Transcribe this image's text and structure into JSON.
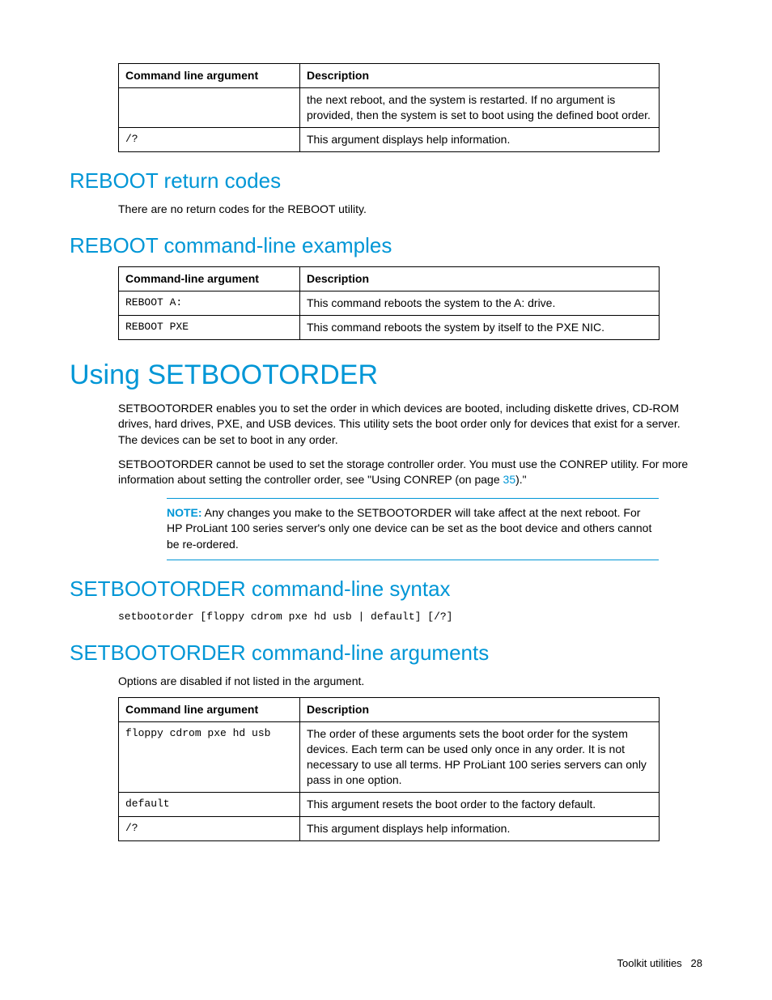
{
  "table1": {
    "headers": {
      "arg": "Command line argument",
      "desc": "Description"
    },
    "rows": [
      {
        "arg": "",
        "desc": "the next reboot, and the system is restarted. If no argument is provided, then the system is set to boot using the defined boot order."
      },
      {
        "arg": "/?",
        "desc": "This argument displays help information."
      }
    ]
  },
  "section1": {
    "heading": "REBOOT return codes",
    "body": "There are no return codes for the REBOOT utility."
  },
  "section2": {
    "heading": "REBOOT command-line examples"
  },
  "table2": {
    "headers": {
      "arg": "Command-line argument",
      "desc": "Description"
    },
    "rows": [
      {
        "arg": "REBOOT A:",
        "desc": "This command reboots the system to the A: drive."
      },
      {
        "arg": "REBOOT PXE",
        "desc": "This command reboots the system by itself to the PXE NIC."
      }
    ]
  },
  "section3": {
    "heading": "Using SETBOOTORDER",
    "p1": "SETBOOTORDER enables you to set the order in which devices are booted, including diskette drives, CD-ROM drives, hard drives, PXE, and USB devices. This utility sets the boot order only for devices that exist for a server. The devices can be set to boot in any order.",
    "p2_a": "SETBOOTORDER cannot be used to set the storage controller order. You must use the CONREP utility. For more information about setting the controller order, see \"Using CONREP (on page ",
    "p2_link": "35",
    "p2_b": ").\"",
    "note_label": "NOTE:",
    "note": "  Any changes you make to the SETBOOTORDER will take affect at the next reboot. For HP ProLiant 100 series server's only one device can be set as the boot device and others cannot be re-ordered."
  },
  "section4": {
    "heading": "SETBOOTORDER command-line syntax",
    "code": "setbootorder [floppy cdrom pxe hd usb | default] [/?]"
  },
  "section5": {
    "heading": "SETBOOTORDER command-line arguments",
    "body": "Options are disabled if not listed in the argument."
  },
  "table3": {
    "headers": {
      "arg": "Command line argument",
      "desc": "Description"
    },
    "rows": [
      {
        "arg": "floppy cdrom pxe hd usb",
        "desc": "The order of these arguments sets the boot order for the system devices. Each term can be used only once in any order. It is not necessary to use all terms. HP ProLiant 100 series servers can only pass in one option."
      },
      {
        "arg": "default",
        "desc": "This argument resets the boot order to the factory default."
      },
      {
        "arg": "/?",
        "desc": "This argument displays help information."
      }
    ]
  },
  "footer": {
    "section": "Toolkit utilities",
    "page": "28"
  }
}
